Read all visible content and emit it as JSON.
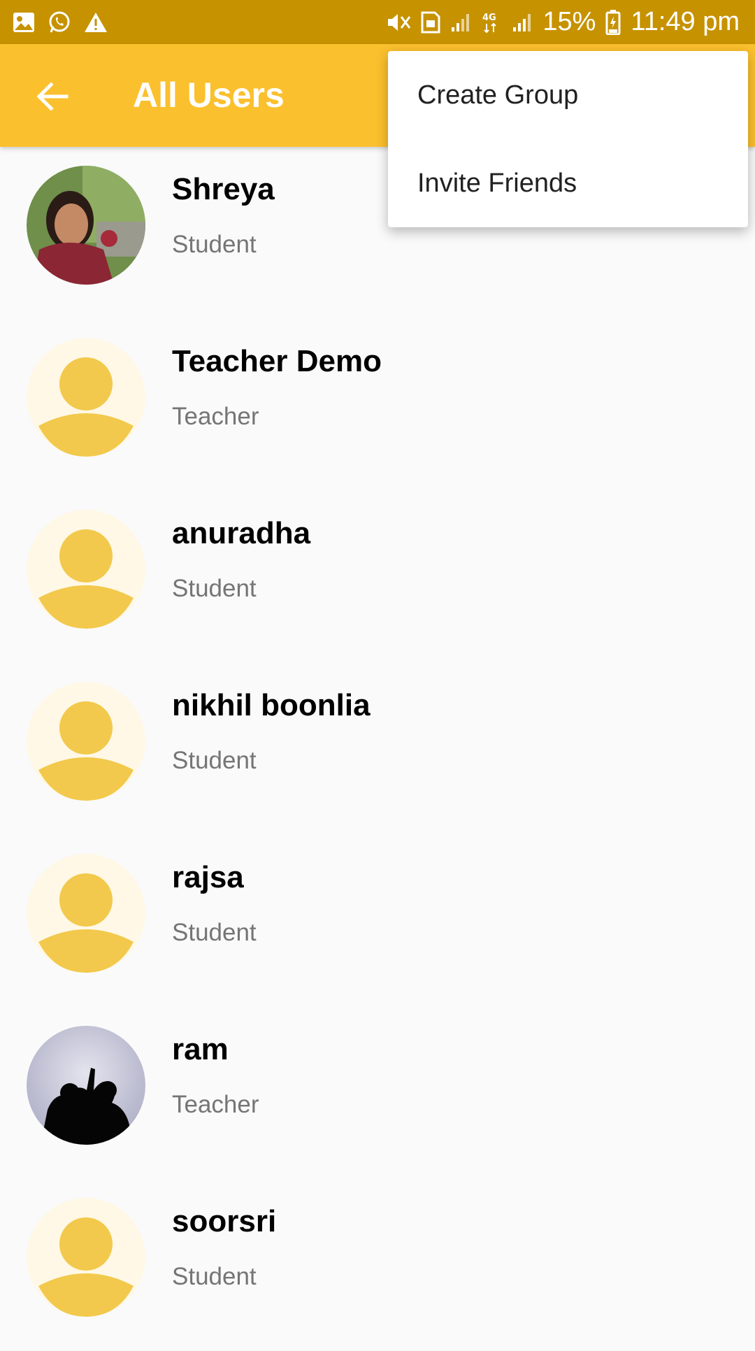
{
  "status_bar": {
    "battery": "15%",
    "time": "11:49 pm",
    "left_icons": [
      "gallery-icon",
      "whatsapp-icon",
      "warning-icon"
    ],
    "right_icons": [
      "mute-icon",
      "sim-icon",
      "signal-icon",
      "network-4g-icon",
      "signal-icon",
      "battery-charging-icon"
    ]
  },
  "app_bar": {
    "title": "All Users",
    "back_icon": "arrow-left-icon",
    "color": "#fbc02d"
  },
  "menu": {
    "items": [
      {
        "label": "Create Group"
      },
      {
        "label": "Invite Friends"
      }
    ]
  },
  "users": [
    {
      "name": "Shreya",
      "role": "Student",
      "avatar": "photo-woman"
    },
    {
      "name": "Teacher Demo",
      "role": "Teacher",
      "avatar": "default"
    },
    {
      "name": "anuradha",
      "role": "Student",
      "avatar": "default"
    },
    {
      "name": "nikhil boonlia",
      "role": "Student",
      "avatar": "default"
    },
    {
      "name": "rajsa",
      "role": "Student",
      "avatar": "default"
    },
    {
      "name": "ram",
      "role": "Teacher",
      "avatar": "photo-silhouette"
    },
    {
      "name": "soorsri",
      "role": "Student",
      "avatar": "default"
    }
  ],
  "colors": {
    "status_bar": "#c69200",
    "accent": "#fbc02d",
    "avatar_fg": "#f2c94c",
    "avatar_bg": "#fff8e6"
  }
}
